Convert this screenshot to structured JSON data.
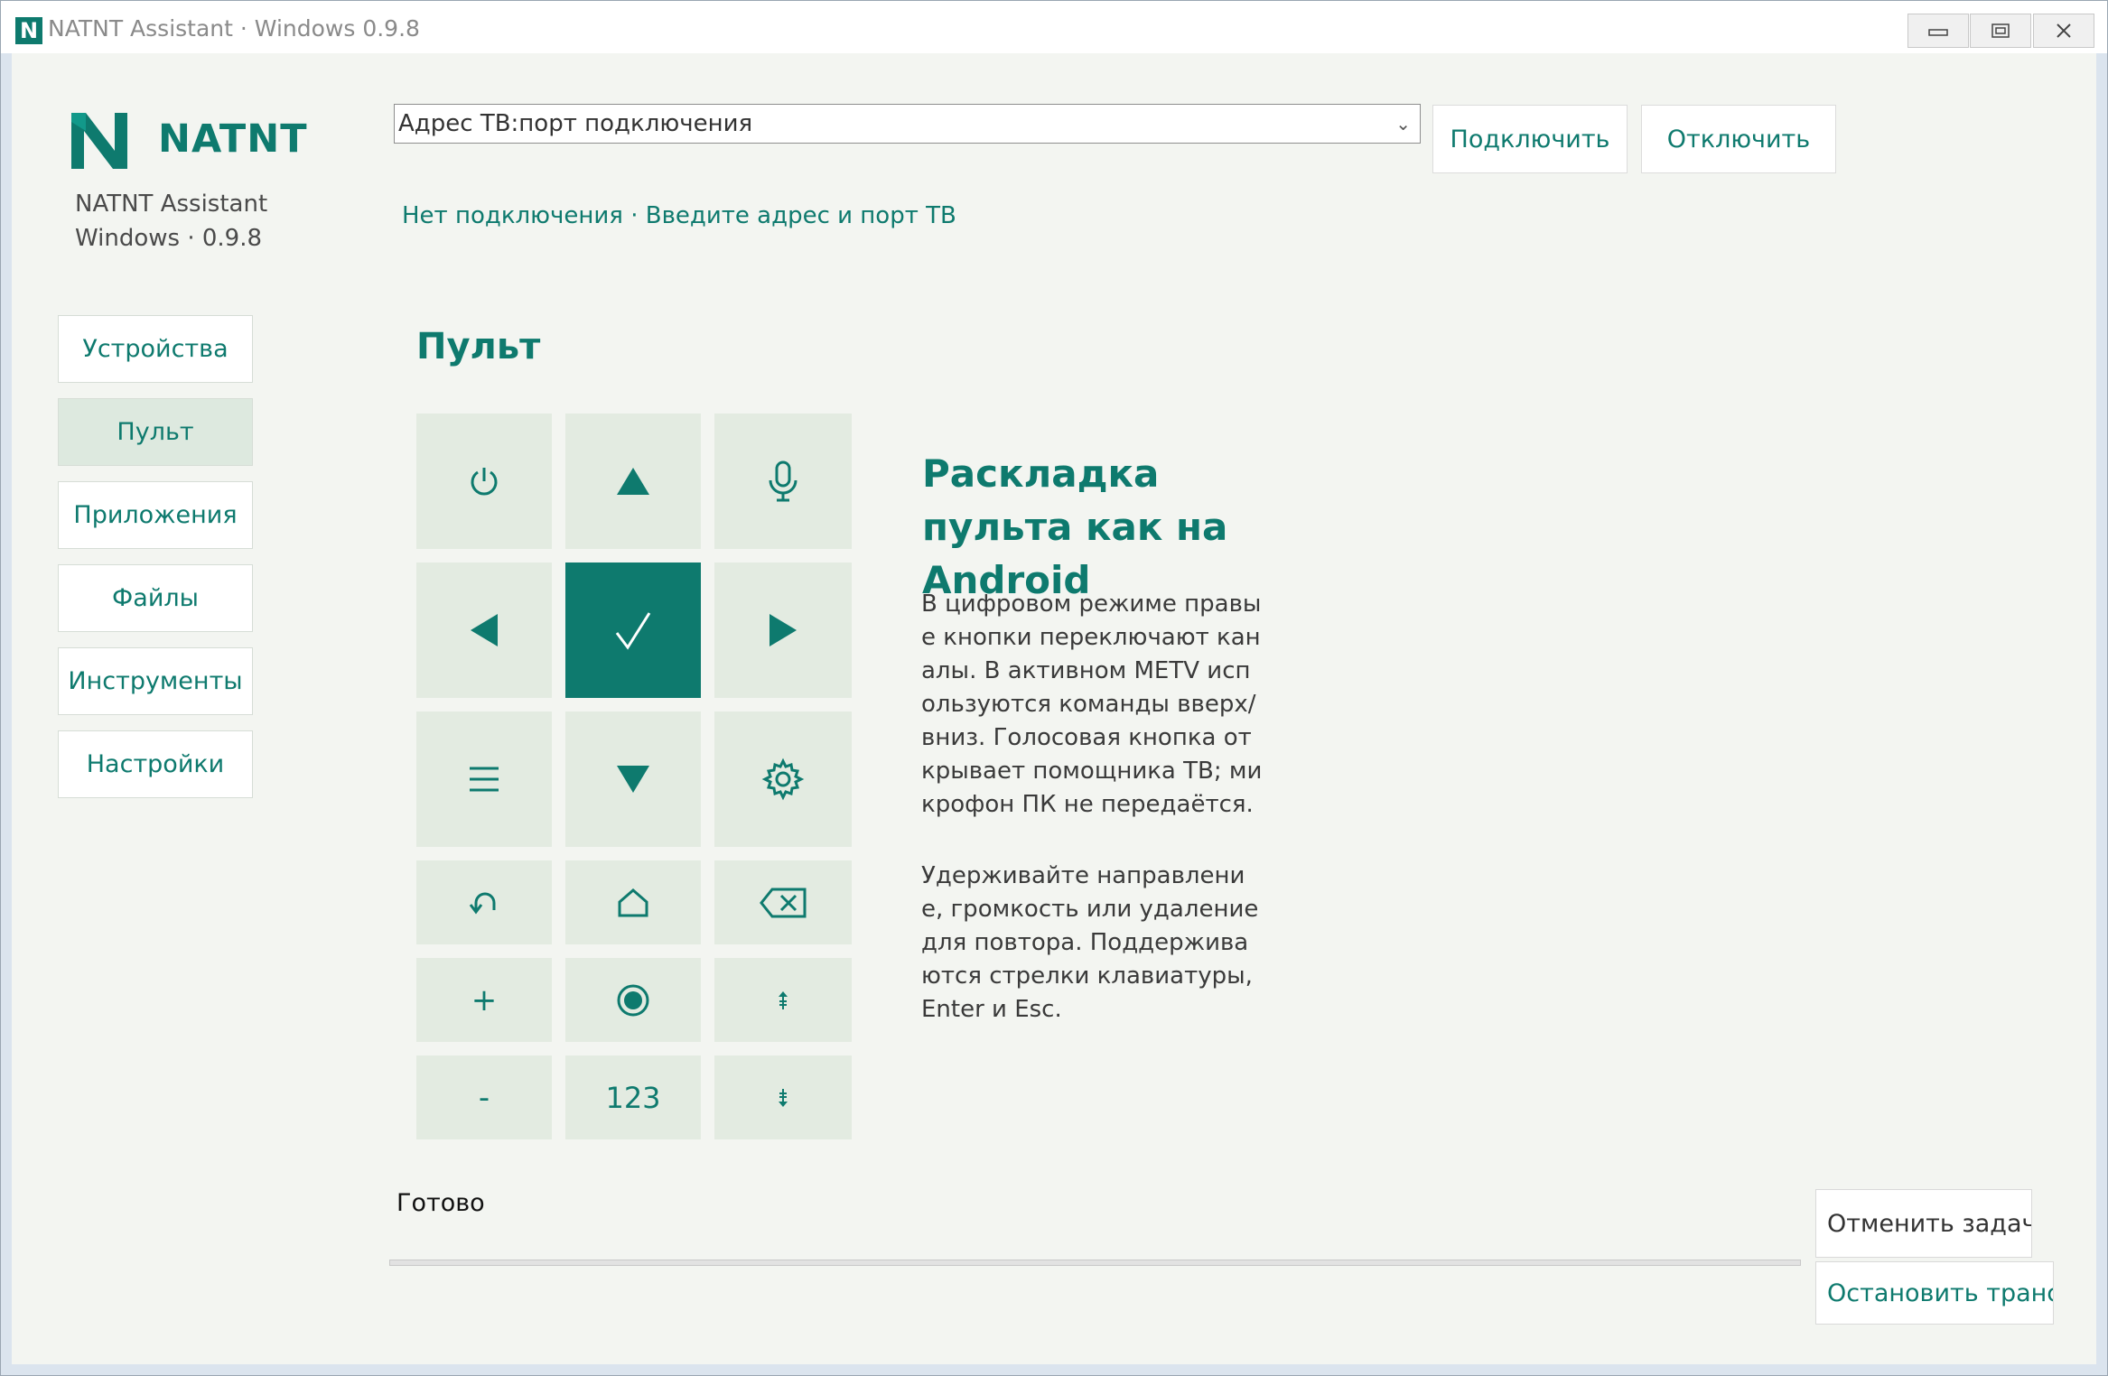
{
  "window": {
    "title": "NATNT Assistant · Windows 0.9.8",
    "logo_letter": "N",
    "controls": [
      "minimize",
      "restore",
      "close"
    ]
  },
  "sidebar": {
    "brand": "NATNT",
    "app_name": "NATNT Assistant",
    "version_line": "Windows · 0.9.8",
    "items": [
      {
        "label": "Устройства",
        "active": false
      },
      {
        "label": "Пульт",
        "active": true
      },
      {
        "label": "Приложения",
        "active": false
      },
      {
        "label": "Файлы",
        "active": false
      },
      {
        "label": "Инструменты",
        "active": false
      },
      {
        "label": "Настройки",
        "active": false
      }
    ]
  },
  "header": {
    "address_value": "Адрес ТВ:порт подключения",
    "connect_label": "Подключить",
    "disconnect_label": "Отключить",
    "status": "Нет подключения · Введите адрес и порт ТВ"
  },
  "remote": {
    "title": "Пульт",
    "keys": [
      {
        "name": "power",
        "icon": "power-icon"
      },
      {
        "name": "up",
        "icon": "arrow-up-icon"
      },
      {
        "name": "voice",
        "icon": "microphone-icon"
      },
      {
        "name": "left",
        "icon": "arrow-left-icon"
      },
      {
        "name": "ok",
        "icon": "check-icon"
      },
      {
        "name": "right",
        "icon": "arrow-right-icon"
      },
      {
        "name": "menu",
        "icon": "menu-icon"
      },
      {
        "name": "down",
        "icon": "arrow-down-icon"
      },
      {
        "name": "settings",
        "icon": "gear-icon"
      },
      {
        "name": "back",
        "icon": "back-icon"
      },
      {
        "name": "home",
        "icon": "home-icon"
      },
      {
        "name": "delete",
        "icon": "backspace-icon"
      },
      {
        "name": "volume-up",
        "label": "+"
      },
      {
        "name": "record",
        "icon": "record-icon"
      },
      {
        "name": "channel-up",
        "icon": "channel-up-icon"
      },
      {
        "name": "volume-down",
        "label": "-"
      },
      {
        "name": "numbers",
        "label": "123"
      },
      {
        "name": "channel-down",
        "icon": "channel-down-icon"
      }
    ],
    "accent_color": "#0e7a6e",
    "key_color": "#e3ebe1"
  },
  "info": {
    "title": "Раскладка пульта как на Android",
    "paragraph1": "В цифровом режиме правые кнопки переключают каналы. В активном METV используются команды вверх/вниз. Голосовая кнопка открывает помощника ТВ; микрофон ПК не передаётся.",
    "paragraph2": "Удерживайте направление, громкость или удаление для повтора. Поддерживаются стрелки клавиатуры, Enter и Esc."
  },
  "footer": {
    "status": "Готово",
    "progress": 0,
    "cancel_label": "Отменить задачу",
    "stop_label": "Остановить трансл"
  }
}
